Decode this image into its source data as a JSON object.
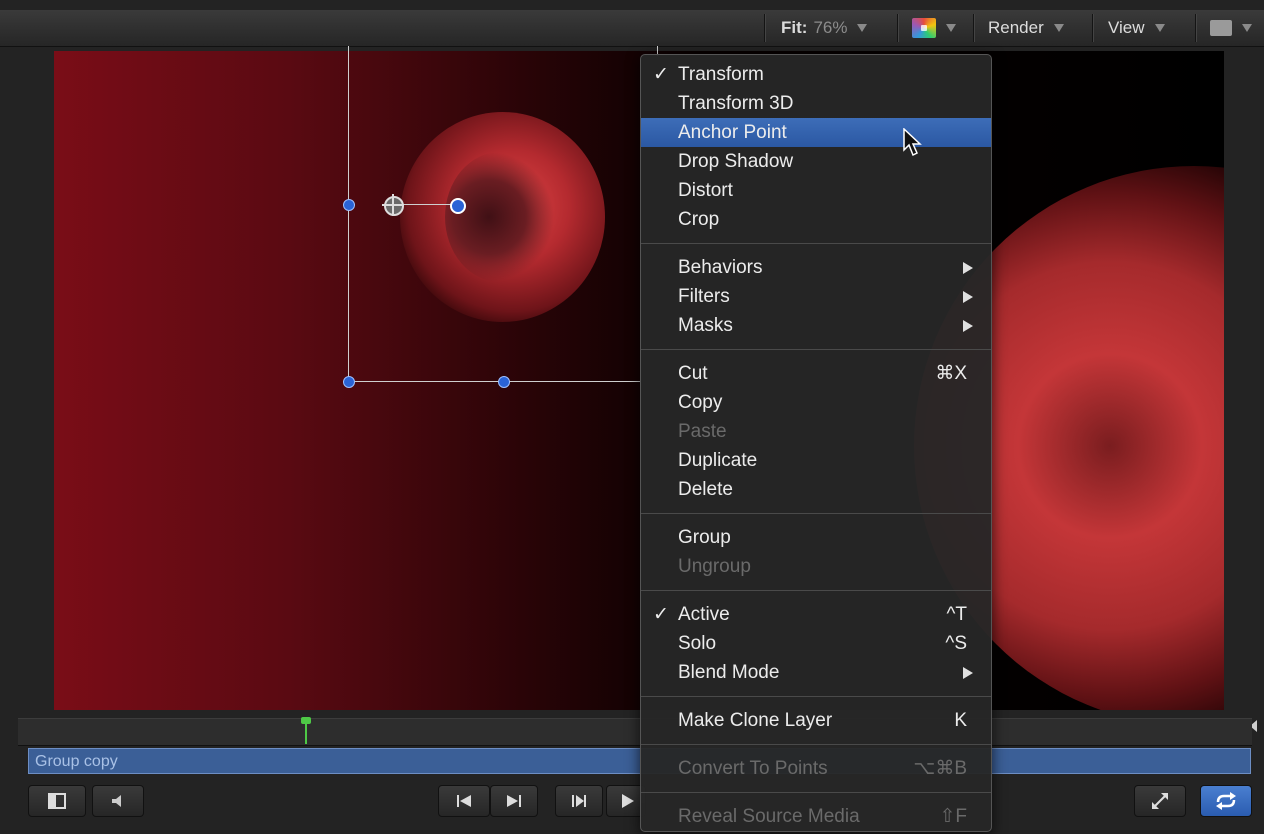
{
  "toolbar": {
    "fit_label": "Fit:",
    "fit_value": "76%",
    "color_icon": "color-swatch-icon",
    "render_label": "Render",
    "view_label": "View",
    "layout_icon": "viewer-layout-icon"
  },
  "context_menu": {
    "sections": [
      [
        {
          "label": "Transform",
          "checked": true
        },
        {
          "label": "Transform 3D"
        },
        {
          "label": "Anchor Point",
          "highlighted": true
        },
        {
          "label": "Drop Shadow"
        },
        {
          "label": "Distort"
        },
        {
          "label": "Crop"
        }
      ],
      [
        {
          "label": "Behaviors",
          "submenu": true
        },
        {
          "label": "Filters",
          "submenu": true
        },
        {
          "label": "Masks",
          "submenu": true
        }
      ],
      [
        {
          "label": "Cut",
          "shortcut": "⌘X"
        },
        {
          "label": "Copy"
        },
        {
          "label": "Paste",
          "disabled": true
        },
        {
          "label": "Duplicate"
        },
        {
          "label": "Delete"
        }
      ],
      [
        {
          "label": "Group"
        },
        {
          "label": "Ungroup",
          "disabled": true
        }
      ],
      [
        {
          "label": "Active",
          "checked": true,
          "shortcut": "^T"
        },
        {
          "label": "Solo",
          "shortcut": "^S"
        },
        {
          "label": "Blend Mode",
          "submenu": true
        }
      ],
      [
        {
          "label": "Make Clone Layer",
          "shortcut": "K"
        }
      ],
      [
        {
          "label": "Convert To Points",
          "shortcut": "⌥⌘B",
          "disabled": true
        }
      ],
      [
        {
          "label": "Reveal Source Media",
          "shortcut": "⇧F",
          "disabled": true
        }
      ]
    ]
  },
  "timeline": {
    "track_label": "Group copy"
  },
  "transport": {
    "go_start_icon": "go-to-start-icon",
    "go_end_icon": "go-to-end-icon",
    "step_icon": "step-forward-icon",
    "play_icon": "play-icon"
  },
  "colors": {
    "menu_highlight": "#2b58a3",
    "track": "#3b5f97",
    "playhead": "#4ec946"
  }
}
